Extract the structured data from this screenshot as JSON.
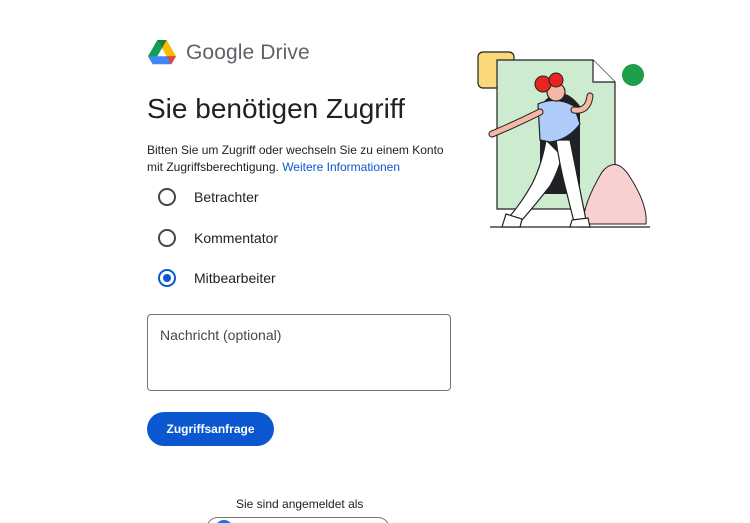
{
  "logo": {
    "text": "Google Drive"
  },
  "title": "Sie benötigen Zugriff",
  "description": {
    "text": "Bitten Sie um Zugriff oder wechseln Sie zu einem Konto mit Zugriffsberechtigung.",
    "link": "Weitere Informationen"
  },
  "roles": [
    {
      "label": "Betrachter",
      "checked": false
    },
    {
      "label": "Kommentator",
      "checked": false
    },
    {
      "label": "Mitbearbeiter",
      "checked": true
    }
  ],
  "message": {
    "placeholder": "Nachricht (optional)",
    "value": ""
  },
  "request_button": {
    "label": "Zugriffsanfrage"
  },
  "signed_in": {
    "text": "Sie sind angemeldet als"
  },
  "colors": {
    "accent": "#0b57d0",
    "doc_green": "#cdeccf",
    "green_dot": "#1e9e4a",
    "pink": "#f8d0d0",
    "yellow": "#fbd97a",
    "red_hair": "#e8241e",
    "shirt_blue": "#aecbfa"
  }
}
